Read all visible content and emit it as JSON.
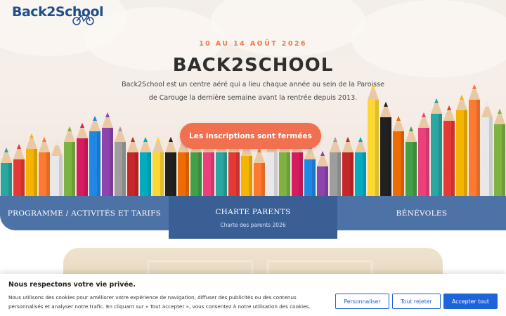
{
  "header": {
    "logo_text": "Back2School"
  },
  "hero": {
    "dates": "10 AU 14 AOÛT 2026",
    "title": "BACK2SCHOOL",
    "description": "Back2School est un centre aéré qui a lieu chaque année au sein de la Paroisse de Carouge la dernière semaine avant la rentrée depuis 2013.",
    "cta_label": "Les inscriptions sont fermées"
  },
  "nav": {
    "items": [
      {
        "label": "PROGRAMME / ACTIVITÉS ET TARIFS"
      },
      {
        "label": "CHARTE PARENTS",
        "sublink": "Charte des parents 2026"
      },
      {
        "label": "BÉNÉVOLES"
      }
    ]
  },
  "cookie_banner": {
    "title": "Nous respectons votre vie privée.",
    "text": "Nous utilisons des cookies pour améliorer votre expérience de navigation, diffuser des publicités ou des contenus personnalisés et analyser notre trafic. En cliquant sur « Tout accepter », vous consentez à notre utilisation des cookies.",
    "customize_label": "Personnaliser",
    "reject_label": "Tout rejeter",
    "accept_label": "Accepter tout"
  },
  "colors": {
    "accent": "#f07050",
    "nav_blue": "#4d72a6",
    "nav_active": "#3a5f95",
    "button_blue": "#1d63d9",
    "title_dark": "#2f2f2f"
  },
  "icons": [
    "bicycle-icon"
  ]
}
